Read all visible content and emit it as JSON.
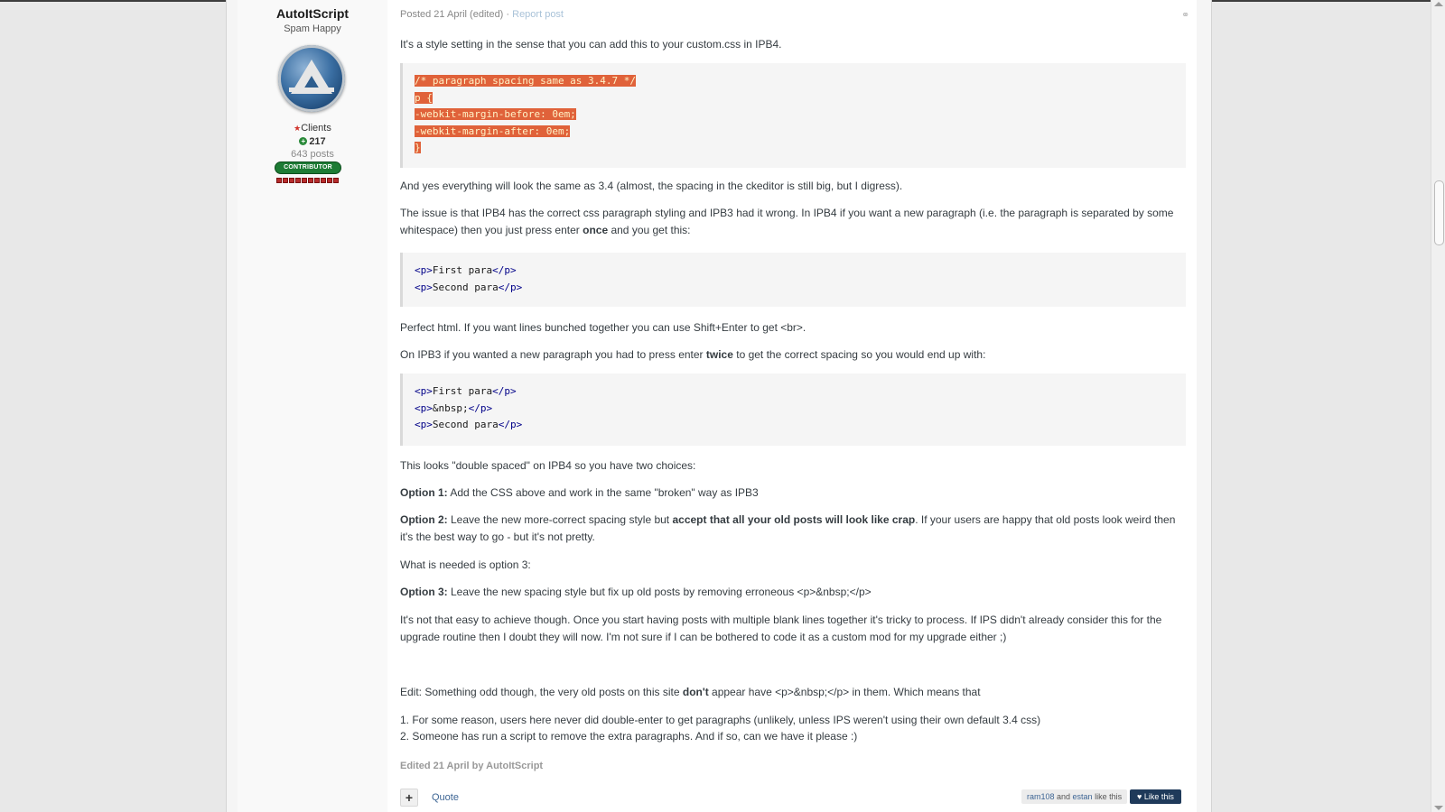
{
  "author": {
    "name": "AutoItScript",
    "title": "Spam Happy",
    "group_star": "★",
    "group": "Clients",
    "reputation": "217",
    "post_count": "643 posts",
    "badge": "CONTRIBUTOR",
    "pips": 10
  },
  "post": {
    "posted": "Posted 21 April (edited) · ",
    "report": "Report post",
    "p1": "It's a style setting in the sense that you can add this to your custom.css in IPB4.",
    "code1": [
      "/* paragraph spacing same as 3.4.7 */",
      "p {",
      "-webkit-margin-before: 0em;",
      "-webkit-margin-after: 0em;",
      "}"
    ],
    "p2": "And yes everything will look the same as 3.4 (almost, the spacing in the ckeditor is still big, but I digress).",
    "p3a": "The issue is that IPB4 has the correct css paragraph styling and IPB3 had it wrong. In IPB4 if you want a new paragraph (i.e. the paragraph is separated by some whitespace) then you just press enter ",
    "p3b": "once",
    "p3c": " and you get this:",
    "code2": [
      {
        "o": "<p>",
        "t": "First para",
        "c": "</p>"
      },
      {
        "o": "<p>",
        "t": "Second para",
        "c": "</p>"
      }
    ],
    "p4": "Perfect html.  If you want lines bunched together you can use Shift+Enter to get <br>.",
    "p5a": "On IPB3 if you wanted a new paragraph you had to press enter ",
    "p5b": "twice",
    "p5c": " to get the correct spacing so you would end up with:",
    "code3": [
      {
        "o": "<p>",
        "t": "First para",
        "c": "</p>"
      },
      {
        "o": "<p>",
        "t": "&nbsp;",
        "c": "</p>"
      },
      {
        "o": "<p>",
        "t": "Second para",
        "c": "</p>"
      }
    ],
    "p6": "This looks \"double spaced\" on IPB4 so you have two choices:",
    "opt1_label": "Option 1:",
    "opt1": " Add the CSS above and work in the same \"broken\" way as IPB3",
    "opt2_label": "Option 2:",
    "opt2a": " Leave the new more-correct spacing style but ",
    "opt2b": "accept that all your old posts will look like crap",
    "opt2c": ". If your users are happy that old posts look weird then it's the best way to go - but it's not pretty.",
    "p7": "What is needed is option 3:",
    "opt3_label": "Option 3:",
    "opt3": " Leave the new spacing style but fix up old posts by removing erroneous <p>&nbsp;</p>",
    "p8": "It's not that easy to achieve though. Once you start having posts with multiple blank lines together it's tricky to process. If IPS didn't already consider this for the upgrade routine then I doubt they will now. I'm not sure if I can be bothered to code it as a custom mod for my upgrade either ;)",
    "p9a": "Edit: Something odd though, the very old posts on this site ",
    "p9b": "don't",
    "p9c": " appear have <p>&nbsp;</p> in them. Which means that",
    "li1": "1. For some reason, users here never did double-enter to get paragraphs (unlikely, unless IPS weren't using their own default 3.4 css)",
    "li2": "2. Someone has run a script to remove the extra paragraphs.  And if so, can we have it please :)",
    "edited": "Edited 21 April by AutoItScript"
  },
  "footer": {
    "plus": "+",
    "quote": "Quote",
    "liker1": "ram108",
    "likers_and": " and ",
    "liker2": "estan",
    "likers_suffix": " like this",
    "like_label": "Like this",
    "heart_icon": "♥"
  },
  "colors": {
    "highlight": "#e0623a",
    "badge": "#1d7b34",
    "link": "#3d6594",
    "like_button": "#1f3a5a"
  }
}
